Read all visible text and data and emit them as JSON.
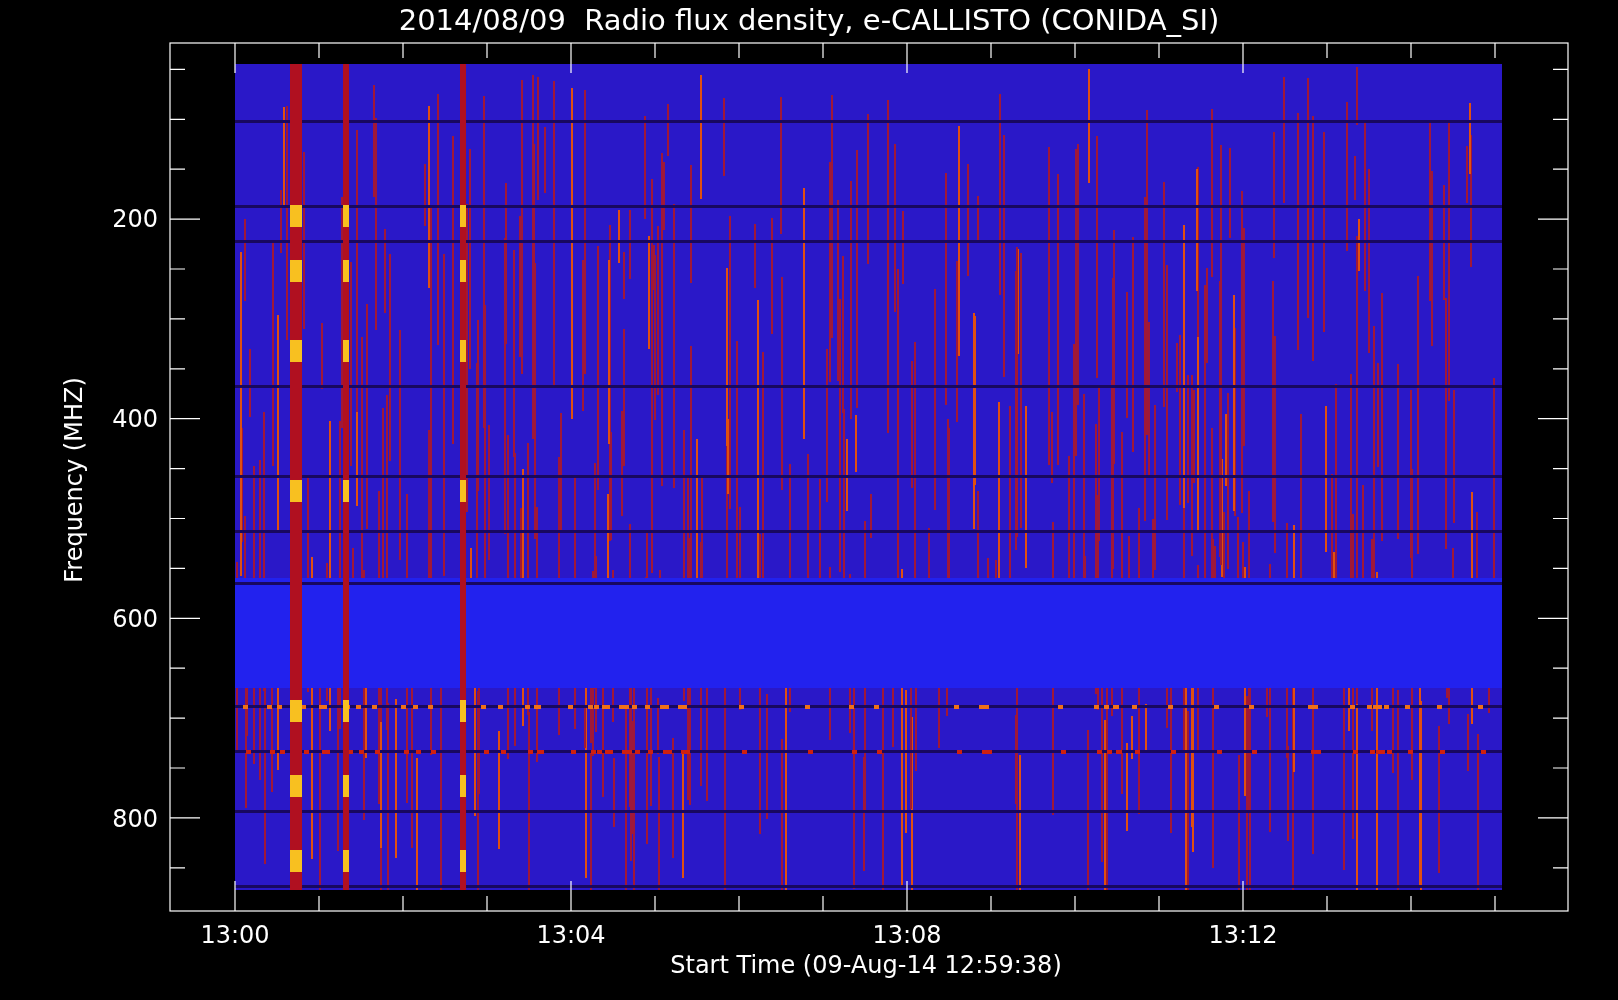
{
  "title": "2014/08/09  Radio flux density, e-CALLISTO (CONIDA_SI)",
  "chart": {
    "y_axis": {
      "label": "Frequency (MHZ)",
      "ticks": [
        "200",
        "400",
        "600",
        "800"
      ]
    },
    "x_axis": {
      "label": "Start Time (09-Aug-14 12:59:38)",
      "ticks": [
        "13:00",
        "13:04",
        "13:08",
        "13:12"
      ]
    }
  }
}
